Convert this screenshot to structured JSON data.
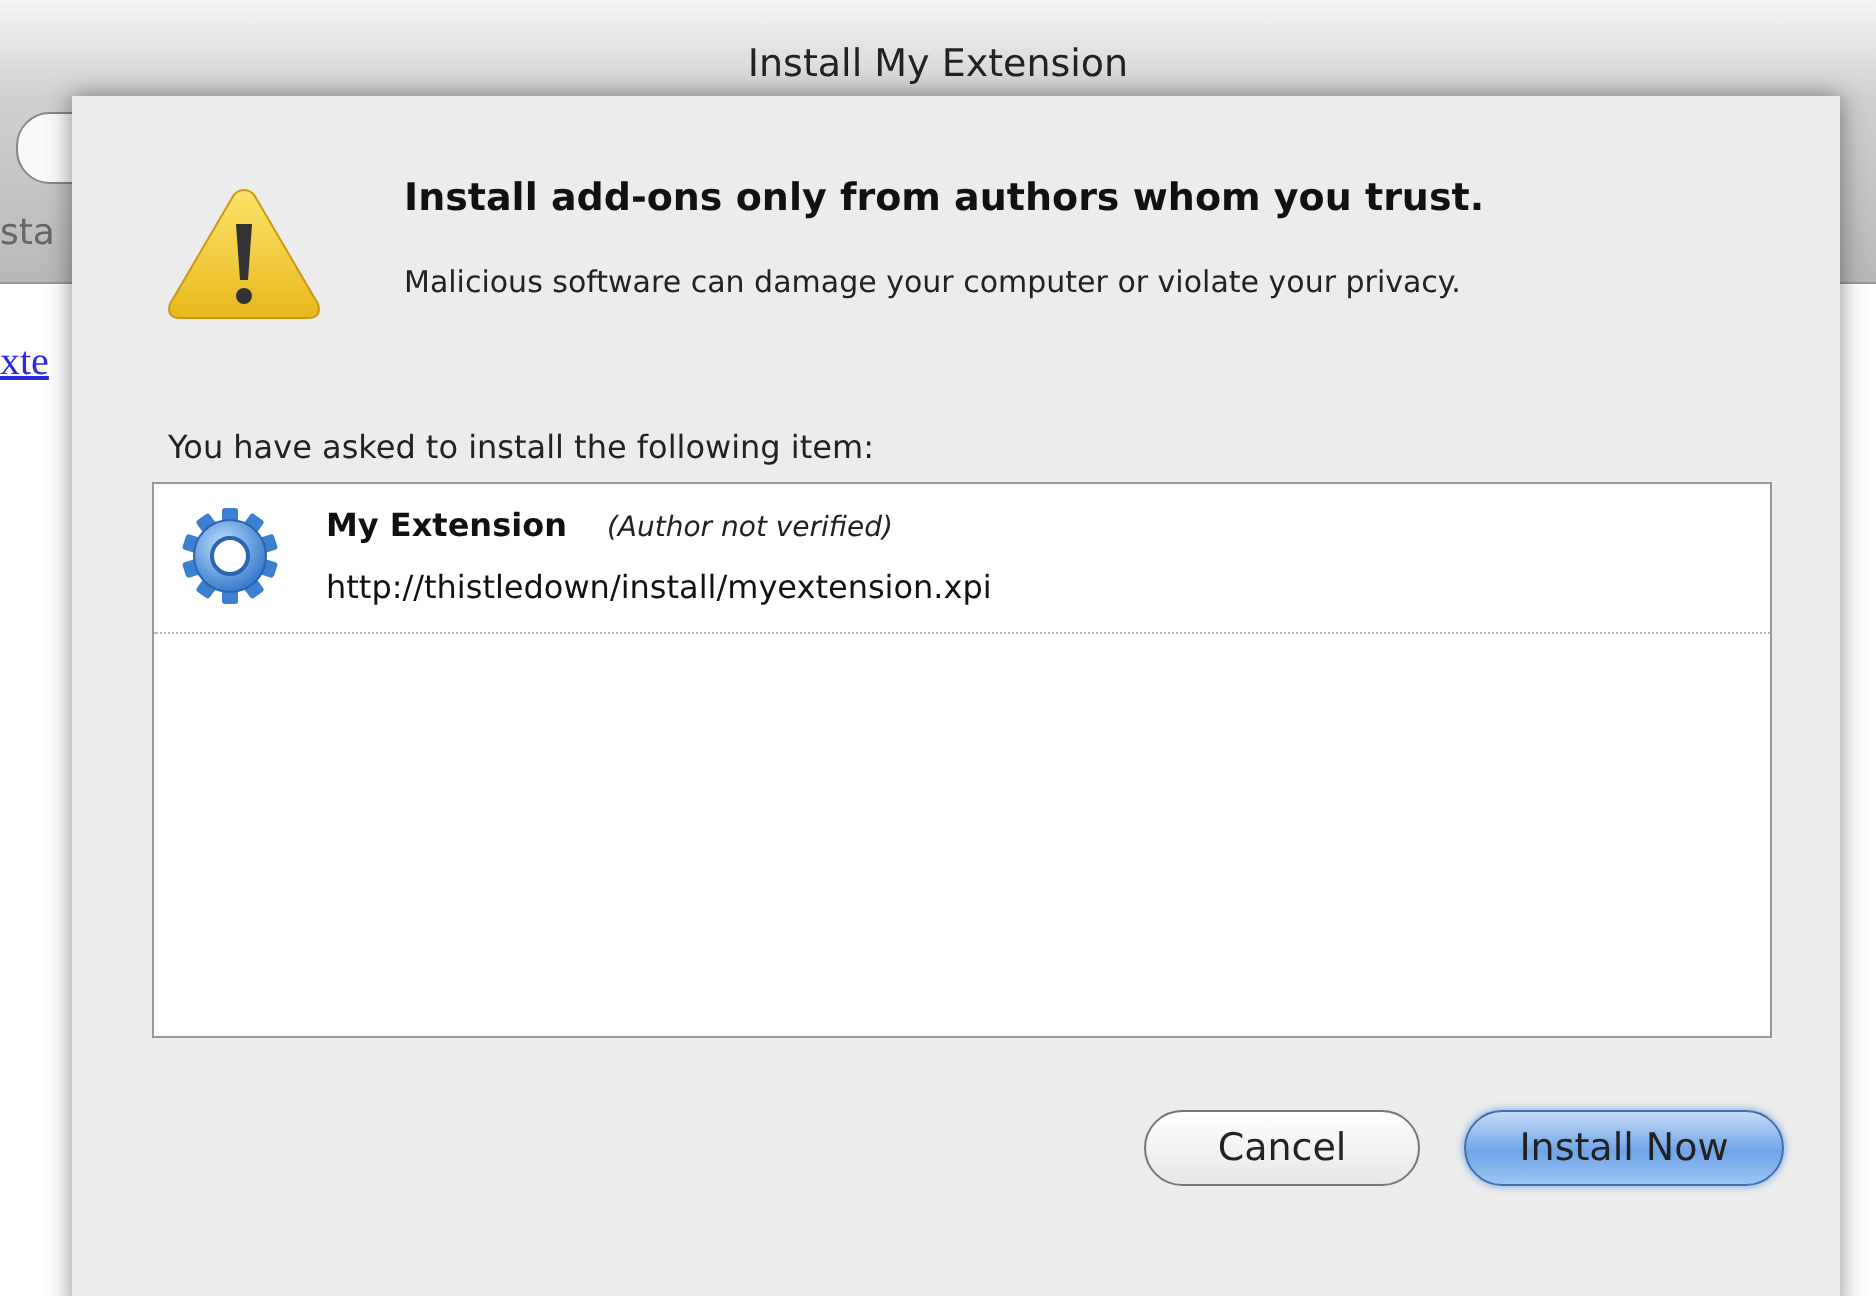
{
  "window": {
    "title": "Install My Extension"
  },
  "background": {
    "tab_text": "sta",
    "link_text": "xte"
  },
  "warning": {
    "heading": "Install add-ons only from authors whom you trust.",
    "message": "Malicious software can damage your computer or violate your privacy."
  },
  "list_label": "You have asked to install the following item:",
  "items": [
    {
      "name": "My Extension",
      "note": "(Author not verified)",
      "url": "http://thistledown/install/myextension.xpi"
    }
  ],
  "buttons": [
    {
      "label": "Cancel",
      "kind": "normal"
    },
    {
      "label": "Install Now",
      "kind": "default"
    }
  ]
}
